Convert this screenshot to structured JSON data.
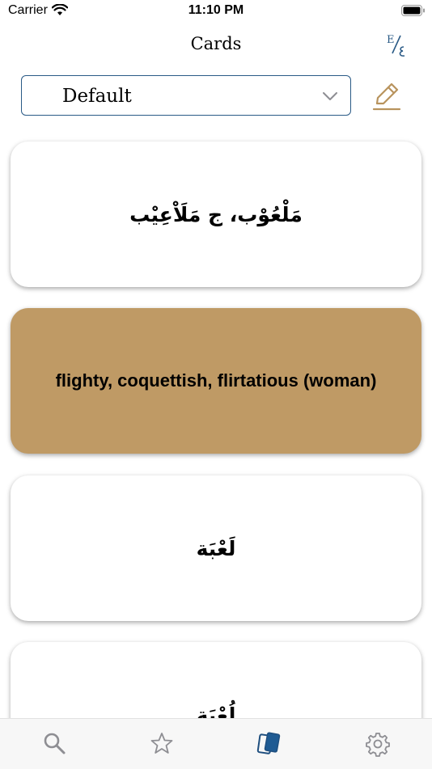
{
  "status": {
    "carrier": "Carrier",
    "time": "11:10 PM"
  },
  "nav": {
    "title": "Cards",
    "lang_toggle_icon": "english-arabic-toggle-icon"
  },
  "deck": {
    "selected": "Default"
  },
  "cards": [
    {
      "text": "مَلْعُوْب، ج مَلَاْعِيْب",
      "lang": "ar",
      "highlight": false
    },
    {
      "text": "flighty, coquettish, flirtatious (woman)",
      "lang": "en",
      "highlight": true
    },
    {
      "text": "لَعْبَة",
      "lang": "ar",
      "highlight": false
    },
    {
      "text": "لُعْبَة",
      "lang": "ar",
      "highlight": false
    }
  ],
  "tabs": [
    "search-icon",
    "star-icon",
    "cards-icon",
    "gear-icon"
  ],
  "colors": {
    "accent_blue": "#2a5a86",
    "card_gold": "#bf9a65",
    "edit_gold": "#b8935d"
  }
}
